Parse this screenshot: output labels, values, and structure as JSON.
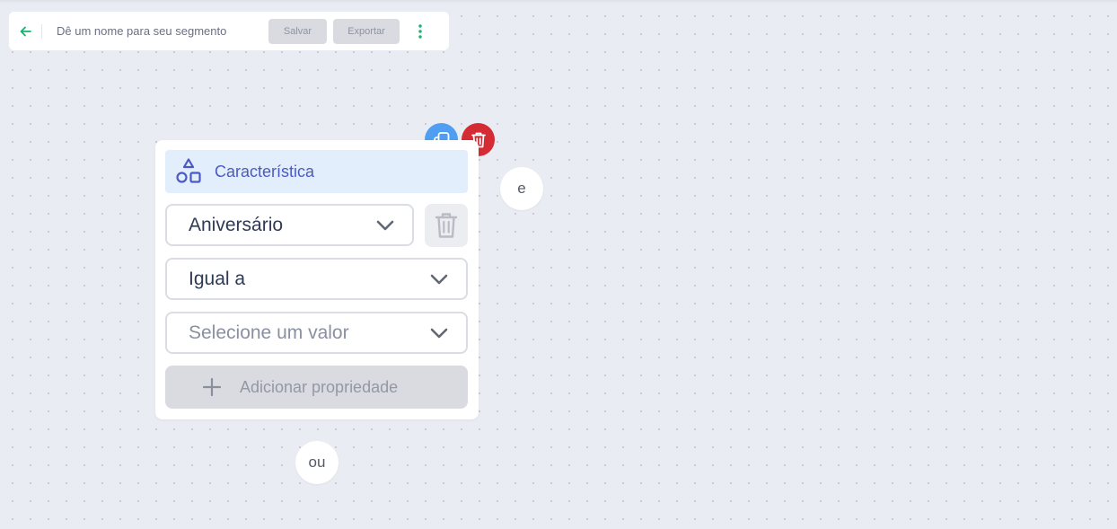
{
  "toolbar": {
    "back_icon": "arrow-left-icon",
    "segment_name_placeholder": "Dê um nome para seu segmento",
    "segment_name_value": "",
    "save_label": "Salvar",
    "export_label": "Exportar",
    "menu_icon": "kebab-menu-icon"
  },
  "card": {
    "header": {
      "icon": "shapes-icon",
      "title": "Característica"
    },
    "property_select": {
      "value": "Aniversário"
    },
    "operator_select": {
      "value": "Igual a"
    },
    "value_select": {
      "placeholder": "Selecione um valor"
    },
    "add_property_label": "Adicionar propriedade",
    "actions": {
      "duplicate_icon": "copy-icon",
      "delete_icon": "trash-icon"
    }
  },
  "connectors": {
    "and_label": "e",
    "or_label": "ou"
  },
  "colors": {
    "accent_green": "#13b570",
    "header_blue": "#4a5ac4",
    "copy_blue": "#4f9ef2",
    "delete_red": "#d42b34",
    "canvas": "#eaecf3"
  }
}
